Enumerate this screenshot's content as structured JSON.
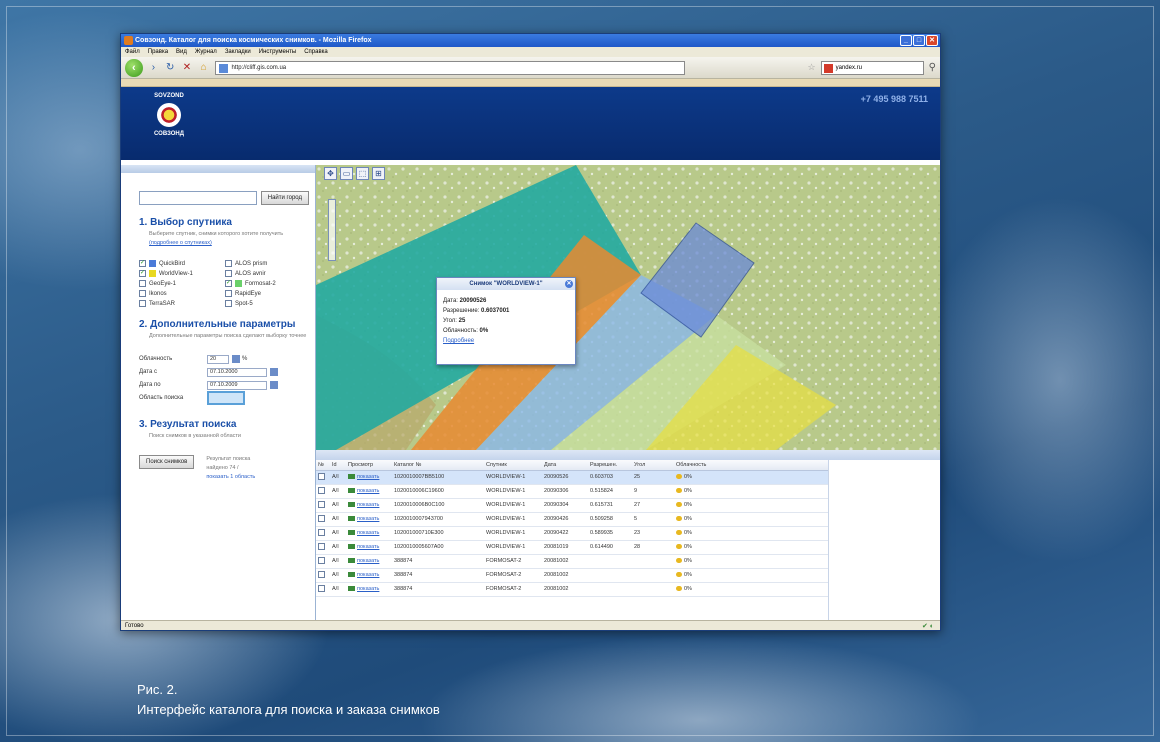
{
  "window": {
    "title": "Совзонд. Каталог для поиска космических снимков. - Mozilla Firefox",
    "menu": [
      "Файл",
      "Правка",
      "Вид",
      "Журнал",
      "Закладки",
      "Инструменты",
      "Справка"
    ],
    "url": "http://cliff.gis.com.ua",
    "search_value": "yandex.ru",
    "status": "Готово"
  },
  "header": {
    "logo_top": "SOVZOND",
    "logo_bottom": "СОВЗОНД",
    "phone": "+7 495 988 7511"
  },
  "left_panel": {
    "search_button": "Найти город",
    "section1": {
      "title": "1. Выбор спутника",
      "desc": "Выберите спутник, снимки которого хотите получить",
      "link": "(подробнее о спутниках)"
    },
    "satellites": [
      {
        "name": "QuickBird",
        "checked": true,
        "color": "#4a7ad8"
      },
      {
        "name": "ALOS prism",
        "checked": false,
        "color": ""
      },
      {
        "name": "WorldView-1",
        "checked": true,
        "color": "#e8d820"
      },
      {
        "name": "ALOS avnir",
        "checked": false,
        "color": ""
      },
      {
        "name": "GeoEye-1",
        "checked": false,
        "color": ""
      },
      {
        "name": "Formosat-2",
        "checked": true,
        "color": "#6ad06a"
      },
      {
        "name": "Ikonos",
        "checked": false,
        "color": ""
      },
      {
        "name": "RapidEye",
        "checked": false,
        "color": ""
      },
      {
        "name": "TerraSAR",
        "checked": false,
        "color": ""
      },
      {
        "name": "Spot-5",
        "checked": false,
        "color": ""
      }
    ],
    "section2": {
      "title": "2. Дополнительные параметры",
      "desc": "Дополнительные параметры поиска сделают выборку точнее"
    },
    "params": {
      "cloud_label": "Облачность",
      "cloud_value": "20",
      "cloud_unit": "%",
      "date_from_label": "Дата с",
      "date_from_value": "07.10.2000",
      "date_to_label": "Дата по",
      "date_to_value": "07.10.2009",
      "area_label": "Область поиска"
    },
    "section3": {
      "title": "3. Результат поиска",
      "desc": "Поиск снимков в указанной области"
    },
    "find_button": "Поиск снимков",
    "result_text": "Результат поиска",
    "result_found": "найдено 74 /",
    "result_link": "показать 1 область"
  },
  "popup": {
    "title": "Снимок \"WORLDVIEW-1\"",
    "date_label": "Дата:",
    "date_value": "20090526",
    "res_label": "Разрешение:",
    "res_value": "0.6037001",
    "angle_label": "Угол:",
    "angle_value": "25",
    "cloud_label": "Облачность:",
    "cloud_value": "0%",
    "link": "Подробнее"
  },
  "table": {
    "headers": [
      "№",
      "Id",
      "Просмотр",
      "Каталог №",
      "Спутник",
      "Дата",
      "Разрешен.",
      "Угол",
      "Облачность"
    ],
    "rows": [
      {
        "n": "1",
        "id": "A/I",
        "view": "показать",
        "catalog": "1020010007BB5100",
        "sat": "WORLDVIEW-1",
        "date": "20090526",
        "res": "0.603703",
        "angle": "25",
        "cloud": "0%"
      },
      {
        "n": "2",
        "id": "A/I",
        "view": "показать",
        "catalog": "1020010006C19600",
        "sat": "WORLDVIEW-1",
        "date": "20090306",
        "res": "0.515824",
        "angle": "9",
        "cloud": "0%"
      },
      {
        "n": "3",
        "id": "A/I",
        "view": "показать",
        "catalog": "1020010006B0C100",
        "sat": "WORLDVIEW-1",
        "date": "20090304",
        "res": "0.615731",
        "angle": "27",
        "cloud": "0%"
      },
      {
        "n": "4",
        "id": "A/I",
        "view": "показать",
        "catalog": "1020010007943700",
        "sat": "WORLDVIEW-1",
        "date": "20090426",
        "res": "0.509258",
        "angle": "5",
        "cloud": "0%"
      },
      {
        "n": "5",
        "id": "A/I",
        "view": "показать",
        "catalog": "102001000710E300",
        "sat": "WORLDVIEW-1",
        "date": "20090422",
        "res": "0.589935",
        "angle": "23",
        "cloud": "0%"
      },
      {
        "n": "6",
        "id": "A/I",
        "view": "показать",
        "catalog": "1020010005607A00",
        "sat": "WORLDVIEW-1",
        "date": "20081019",
        "res": "0.614490",
        "angle": "28",
        "cloud": "0%"
      },
      {
        "n": "7",
        "id": "A/I",
        "view": "показать",
        "catalog": "388874",
        "sat": "FORMOSAT-2",
        "date": "20081002",
        "res": "",
        "angle": "",
        "cloud": "0%"
      },
      {
        "n": "8",
        "id": "A/I",
        "view": "показать",
        "catalog": "388874",
        "sat": "FORMOSAT-2",
        "date": "20081002",
        "res": "",
        "angle": "",
        "cloud": "0%"
      },
      {
        "n": "9",
        "id": "A/I",
        "view": "показать",
        "catalog": "388874",
        "sat": "FORMOSAT-2",
        "date": "20081002",
        "res": "",
        "angle": "",
        "cloud": "0%"
      }
    ]
  },
  "caption": {
    "line1": "Рис. 2.",
    "line2": "Интерфейс каталога для поиска и заказа снимков"
  },
  "colors": {
    "accent": "#1a4fa8",
    "header_bg": "#0d3a8a",
    "footprint_teal": "#1fa8a0",
    "footprint_orange": "#e88a30",
    "footprint_blue": "#6a8ad8",
    "footprint_yellow": "#e8e040"
  }
}
